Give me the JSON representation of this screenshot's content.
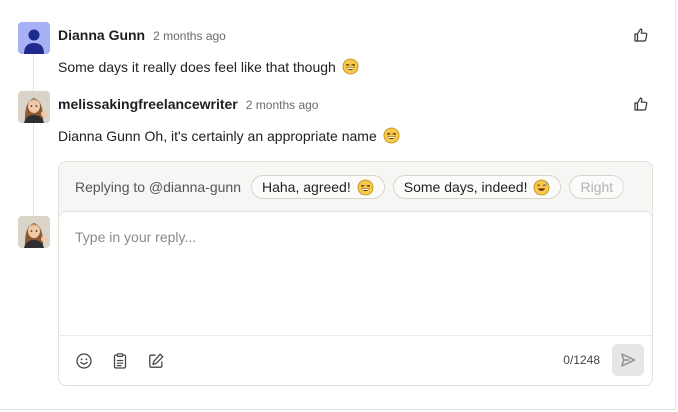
{
  "comments": [
    {
      "author": "Dianna Gunn",
      "time": "2 months ago",
      "text": "Some days it really does feel like that though",
      "emoji": "laughing-emoji",
      "avatar": "default-user-avatar",
      "avatar_color": "#a7b1f5"
    },
    {
      "author": "melissakingfreelancewriter",
      "time": "2 months ago",
      "mention": "Dianna Gunn",
      "text": "Oh, it's certainly an appropriate name",
      "emoji": "laughing-emoji",
      "avatar": "photo-avatar"
    }
  ],
  "reply": {
    "replying_to": "Replying to @dianna-gunn",
    "suggestions": [
      "Haha, agreed!",
      "Some days, indeed!",
      "Right"
    ],
    "placeholder": "Type in your reply...",
    "counter": "0/1248",
    "tools": [
      "emoji-icon",
      "clipboard-icon",
      "edit-icon"
    ],
    "send_icon": "send-icon"
  },
  "colors": {
    "accent_avatar": "#1e2a8c",
    "border": "#e3e1dc",
    "send_bg": "#e6e6e6"
  }
}
